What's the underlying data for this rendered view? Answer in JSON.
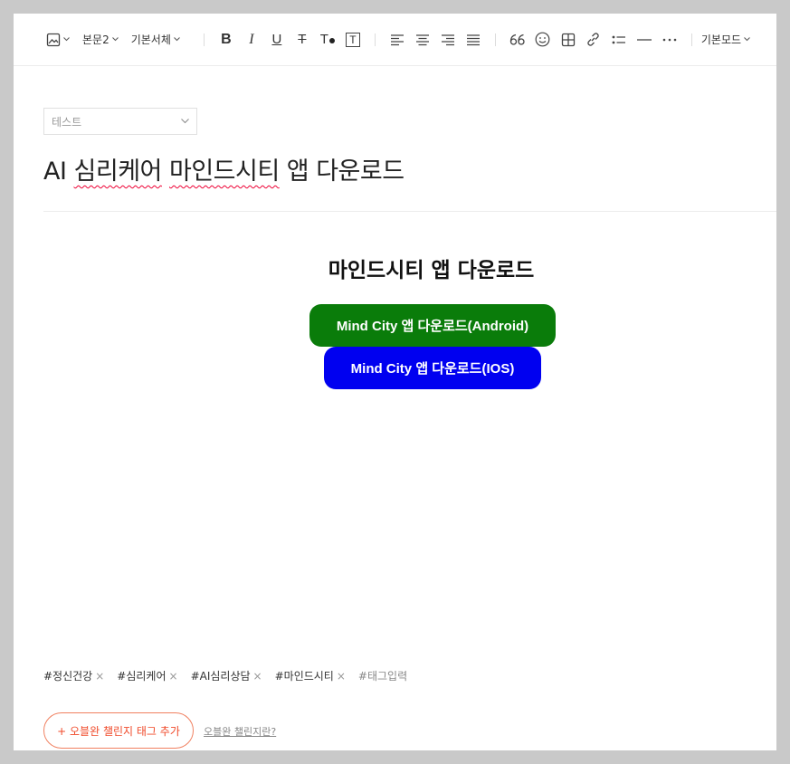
{
  "toolbar": {
    "image_icon": "image-icon",
    "paragraph_style": "본문2",
    "font_family": "기본서체",
    "bold": "B",
    "italic": "I",
    "underline": "U",
    "strike": "T",
    "font_color": "T",
    "bg_color": "T",
    "mode": "기본모드"
  },
  "category": {
    "selected": "테스트"
  },
  "post": {
    "title_parts": [
      "AI",
      " ",
      "심리케어",
      " ",
      "마인드시티",
      " 앱 다운로드"
    ],
    "heading": "마인드시티 앱 다운로드",
    "buttons": [
      {
        "label": "Mind City 앱 다운로드(Android)",
        "color": "#0a7c0a"
      },
      {
        "label": "Mind City 앱 다운로드(IOS)",
        "color": "#0000f0"
      }
    ]
  },
  "tags": {
    "items": [
      "#정신건강",
      "#심리케어",
      "#AI심리상담",
      "#마인드시티"
    ],
    "remove_glyph": "×",
    "placeholder": "#태그입력"
  },
  "challenge": {
    "add_label": "+ 오블완 챌린지 태그 추가",
    "info_link": "오블완 챌린지란?"
  },
  "colors": {
    "accent": "#f04a2a",
    "android_button": "#0a7c0a",
    "ios_button": "#0000f0"
  }
}
